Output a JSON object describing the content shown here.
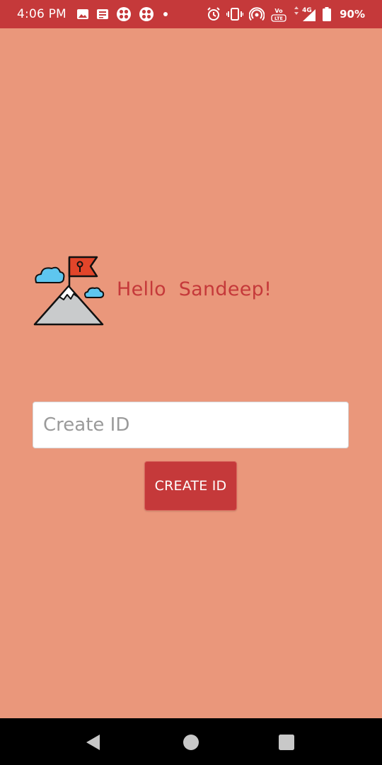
{
  "status_bar": {
    "time": "4:06 PM",
    "battery": "90%",
    "network": "4G",
    "left_icons": [
      "image-icon",
      "news-icon",
      "app-grid-icon",
      "app-grid-icon",
      "dot-icon"
    ],
    "right_icons": [
      "alarm-icon",
      "vibrate-icon",
      "hotspot-icon",
      "volte-icon",
      "signal-icon",
      "battery-icon"
    ]
  },
  "greeting": "Hello  Sandeep!",
  "id_input": {
    "placeholder": "Create ID",
    "value": ""
  },
  "create_button": {
    "label": "CREATE ID"
  },
  "nav_bar": {
    "icons": [
      "back-icon",
      "home-icon",
      "recents-icon"
    ]
  },
  "colors": {
    "background": "#EA977B",
    "accent": "#C5393A",
    "input_bg": "#FFFFFF",
    "nav_bg": "#000000"
  }
}
